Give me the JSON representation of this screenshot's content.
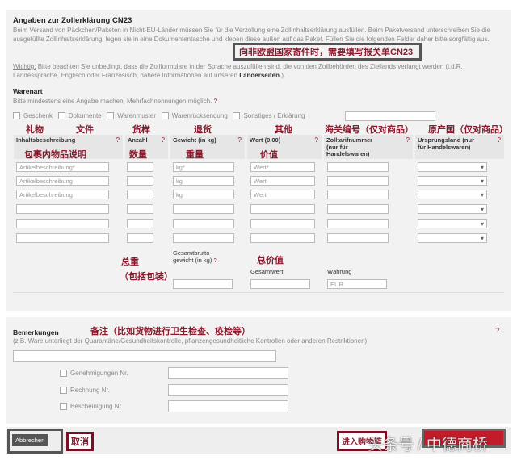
{
  "header": {
    "title": "Angaben zur Zollerklärung CN23",
    "intro": "Beim Versand von Päckchen/Paketen in Nicht-EU-Länder müssen Sie für die Verzollung eine Zollinhaltserklärung ausfüllen. Beim Paketversand unterschreiben Sie die ausgefüllte Zollinhaltserklärung, legen sie in eine Dokumententasche und kleben diese außen auf das Paket. Füllen Sie die folgenden Felder daher bitte sorgfältig aus.",
    "annotation": "向非欧盟国家寄件时，需要填写报关单CN23",
    "wichtig_label": "Wichtig:",
    "wichtig_text": "Bitte beachten Sie unbedingt, dass die Zollformulare in der Sprache auszufüllen sind, die von den Zollbehörden des Ziellands verlangt werden (i.d.R. Landessprache, Englisch oder Französisch, nähere Informationen auf unseren",
    "link": "Länderseiten",
    "link_end": ")."
  },
  "warenart": {
    "title": "Warenart",
    "hint": "Bitte mindestens eine Angabe machen, Mehrfachnennungen möglich.",
    "options": [
      "Geschenk",
      "Dokumente",
      "Warenmuster",
      "Warenrücksendung",
      "Sonstiges / Erklärung"
    ],
    "annotations": [
      "礼物",
      "文件",
      "货样",
      "退货",
      "其他",
      "海关编号（仅对商品）",
      "原产国（仅对商品）"
    ]
  },
  "table": {
    "headers": [
      "Inhaltsbeschreibung",
      "Anzahl",
      "Gewicht (in kg)",
      "Wert (0,00)",
      "Zolltarifnummer (nur für Handelswaren)",
      "Ursprungsland (nur für Handelswaren)"
    ],
    "annotations": [
      "包裹内物品说明",
      "数量",
      "重量",
      "价值"
    ],
    "placeholders": [
      [
        "Artikelbeschreibung*",
        "kg*",
        "Wert*"
      ],
      [
        "Artikelbeschreibung",
        "kg",
        "Wert"
      ],
      [
        "Artikelbeschreibung",
        "kg",
        "Wert"
      ]
    ],
    "help": "?"
  },
  "totals": {
    "weight_label": "Gesamtbrutto-gewicht (in kg)",
    "value_label": "Gesamtwert",
    "currency_label": "Währung",
    "currency_value": "EUR",
    "weight_annotation": "总重",
    "weight_annotation2": "（包括包装）",
    "value_annotation": "总价值"
  },
  "remarks": {
    "title": "Bemerkungen",
    "annotation": "备注（比如货物进行卫生检查、疫检等）",
    "hint": "(z.B. Ware unterliegt der Quarantäne/Gesundheitskontrolle, pflanzengesundheitliche Kontrollen oder anderen Restriktionen)",
    "docs": [
      "Genehmigungen Nr.",
      "Rechnung Nr.",
      "Bescheinigung Nr."
    ]
  },
  "footer": {
    "cancel": "Abbrechen",
    "cancel_annotation": "取消",
    "cart_annotation": "进入购物篮",
    "watermark": "头条号 / 中德商桥"
  }
}
